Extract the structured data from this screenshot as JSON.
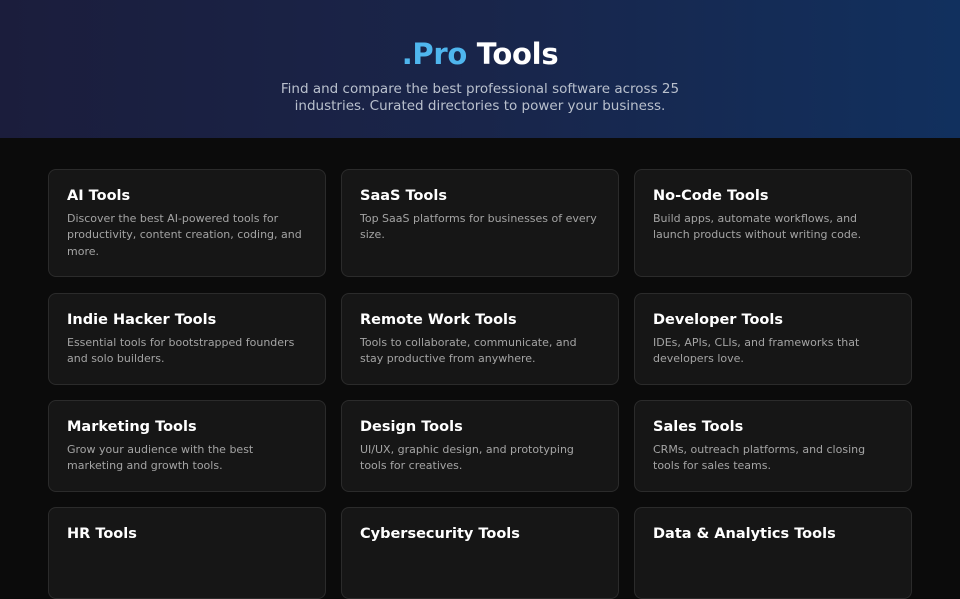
{
  "hero": {
    "brand": ".Pro",
    "title_rest": "Tools",
    "subtitle": "Find and compare the best professional software across 25 industries. Curated directories to power your business."
  },
  "categories": [
    {
      "title": "AI Tools",
      "description": "Discover the best AI-powered tools for productivity, content creation, coding, and more."
    },
    {
      "title": "SaaS Tools",
      "description": "Top SaaS platforms for businesses of every size."
    },
    {
      "title": "No-Code Tools",
      "description": "Build apps, automate workflows, and launch products without writing code."
    },
    {
      "title": "Indie Hacker Tools",
      "description": "Essential tools for bootstrapped founders and solo builders."
    },
    {
      "title": "Remote Work Tools",
      "description": "Tools to collaborate, communicate, and stay productive from anywhere."
    },
    {
      "title": "Developer Tools",
      "description": "IDEs, APIs, CLIs, and frameworks that developers love."
    },
    {
      "title": "Marketing Tools",
      "description": "Grow your audience with the best marketing and growth tools."
    },
    {
      "title": "Design Tools",
      "description": "UI/UX, graphic design, and prototyping tools for creatives."
    },
    {
      "title": "Sales Tools",
      "description": "CRMs, outreach platforms, and closing tools for sales teams."
    },
    {
      "title": "HR Tools",
      "description": ""
    },
    {
      "title": "Cybersecurity Tools",
      "description": ""
    },
    {
      "title": "Data & Analytics Tools",
      "description": ""
    }
  ]
}
